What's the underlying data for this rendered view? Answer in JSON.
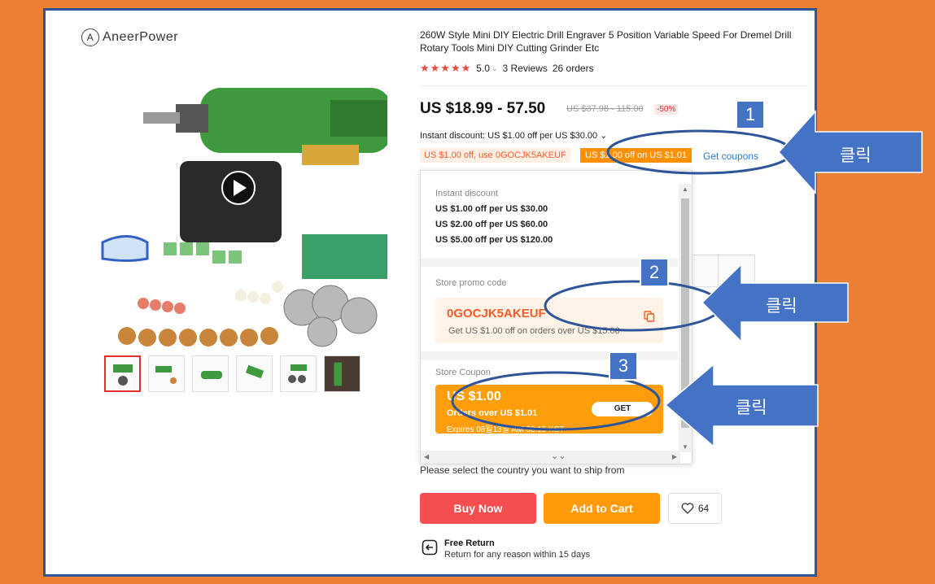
{
  "brand": {
    "name": "AneerPower"
  },
  "product": {
    "title": "260W Style Mini DIY Electric Drill Engraver 5 Position Variable Speed For Dremel Drill Rotary Tools Mini DIY Cutting Grinder Etc",
    "rating": "5.0",
    "reviews": "3 Reviews",
    "orders": "26 orders",
    "stars": "★★★★★",
    "price": "US $18.99 - 57.50",
    "original_price": "US $37.98 - 115.00",
    "discount": "-50%"
  },
  "discounts": {
    "instant_line": "Instant discount: US $1.00 off per US $30.00 ⌄",
    "chip_code": "US $1.00 off, use 0GOCJK5AKEUF",
    "chip_coupon": "US $1.00 off on US $1.01",
    "get_coupons": "Get coupons"
  },
  "panel": {
    "instant_label": "Instant discount",
    "instant_items": [
      "US $1.00 off per US $30.00",
      "US $2.00 off per US $60.00",
      "US $5.00 off per US $120.00"
    ],
    "promo_label": "Store promo code",
    "promo_code": "0GOCJK5AKEUF",
    "promo_desc": "Get US $1.00 off on orders over US $15.00",
    "coupon_label": "Store Coupon",
    "coupon_amount": "US $1.00",
    "coupon_condition": "Orders over US $1.01",
    "coupon_expires": "Expires 08월13일 AM 08:15 KST",
    "coupon_button": "GET"
  },
  "shipping": {
    "text": "Please select the country you want to ship from"
  },
  "actions": {
    "buy": "Buy Now",
    "cart": "Add to Cart",
    "wishlist_count": "64"
  },
  "free_return": {
    "title": "Free Return",
    "desc": "Return for any reason within 15 days"
  },
  "annotations": [
    {
      "number": "1",
      "label": "클릭"
    },
    {
      "number": "2",
      "label": "클릭"
    },
    {
      "number": "3",
      "label": "클릭"
    }
  ],
  "colors": {
    "background": "#ec7f33",
    "frame_border": "#2e5599",
    "callout": "#4472c4",
    "buy": "#f44e50",
    "cart": "#ff9b0a"
  }
}
